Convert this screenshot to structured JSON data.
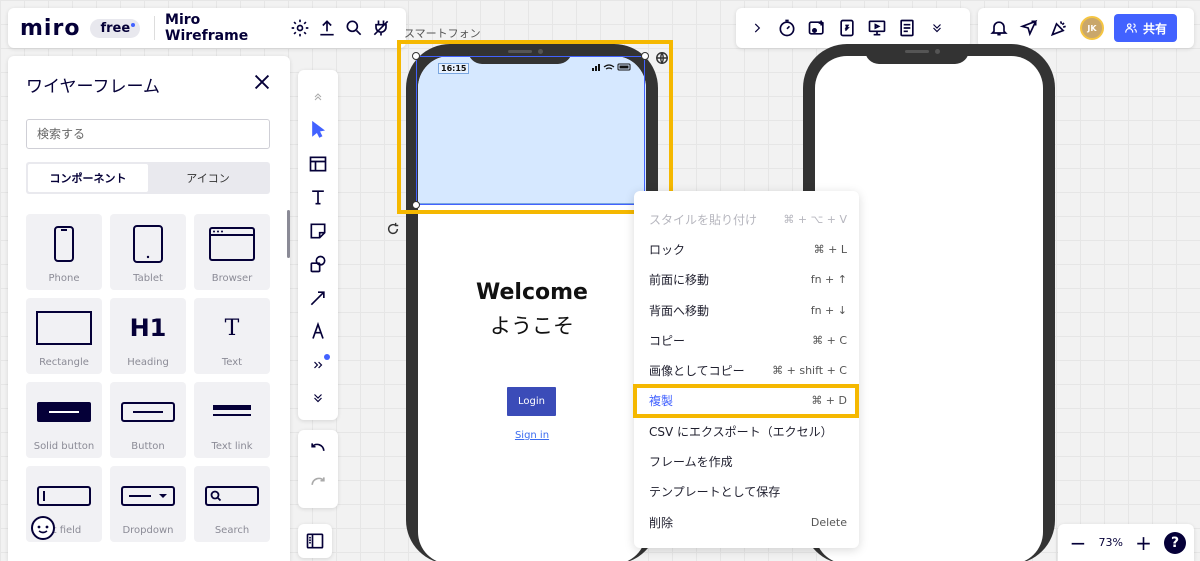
{
  "topbar": {
    "logo": "miro",
    "plan_badge": "free",
    "board_title": "Miro Wireframe",
    "share_label": "共有",
    "avatar_initials": "JK"
  },
  "wireframe_panel": {
    "title": "ワイヤーフレーム",
    "search_placeholder": "検索する",
    "tabs": [
      {
        "label": "コンポーネント",
        "active": true
      },
      {
        "label": "アイコン",
        "active": false
      }
    ],
    "components": [
      {
        "label": "Phone",
        "icon": "phone-icon"
      },
      {
        "label": "Tablet",
        "icon": "tablet-icon"
      },
      {
        "label": "Browser",
        "icon": "browser-icon"
      },
      {
        "label": "Rectangle",
        "icon": "rectangle-icon"
      },
      {
        "label": "Heading",
        "icon": "heading-icon",
        "glyph": "H1"
      },
      {
        "label": "Text",
        "icon": "text-icon",
        "glyph": "T"
      },
      {
        "label": "Solid button",
        "icon": "solid-button-icon"
      },
      {
        "label": "Button",
        "icon": "button-icon"
      },
      {
        "label": "Text link",
        "icon": "text-link-icon"
      },
      {
        "label": "xt field",
        "icon": "text-field-icon"
      },
      {
        "label": "Dropdown",
        "icon": "dropdown-icon"
      },
      {
        "label": "Search",
        "icon": "search-field-icon"
      }
    ]
  },
  "canvas": {
    "frame_label": "スマートフォン",
    "phone": {
      "status_time": "16:15",
      "welcome": "Welcome",
      "welcome_jp": "ようこそ",
      "login_label": "Login",
      "signin_label": "Sign in",
      "header_color": "#d6e8ff"
    }
  },
  "context_menu": {
    "items": [
      {
        "label": "スタイルを貼り付け",
        "shortcut": "⌘ + ⌥ + V",
        "disabled": true
      },
      {
        "label": "ロック",
        "shortcut": "⌘ + L"
      },
      {
        "label": "前面に移動",
        "shortcut": "fn + ↑"
      },
      {
        "label": "背面へ移動",
        "shortcut": "fn + ↓"
      },
      {
        "label": "コピー",
        "shortcut": "⌘ + C"
      },
      {
        "label": "画像としてコピー",
        "shortcut": "⌘ + shift + C"
      },
      {
        "label": "複製",
        "shortcut": "⌘ + D",
        "highlighted": true
      },
      {
        "label": "CSV にエクスポート（エクセル）",
        "shortcut": ""
      },
      {
        "label": "フレームを作成",
        "shortcut": ""
      },
      {
        "label": "テンプレートとして保存",
        "shortcut": ""
      },
      {
        "label": "削除",
        "shortcut": "Delete"
      }
    ]
  },
  "zoom": {
    "minus": "−",
    "level": "73%",
    "plus": "+",
    "help": "?"
  },
  "colors": {
    "accent": "#4262ff",
    "highlight": "#f5b800",
    "phone_body": "#333333"
  }
}
